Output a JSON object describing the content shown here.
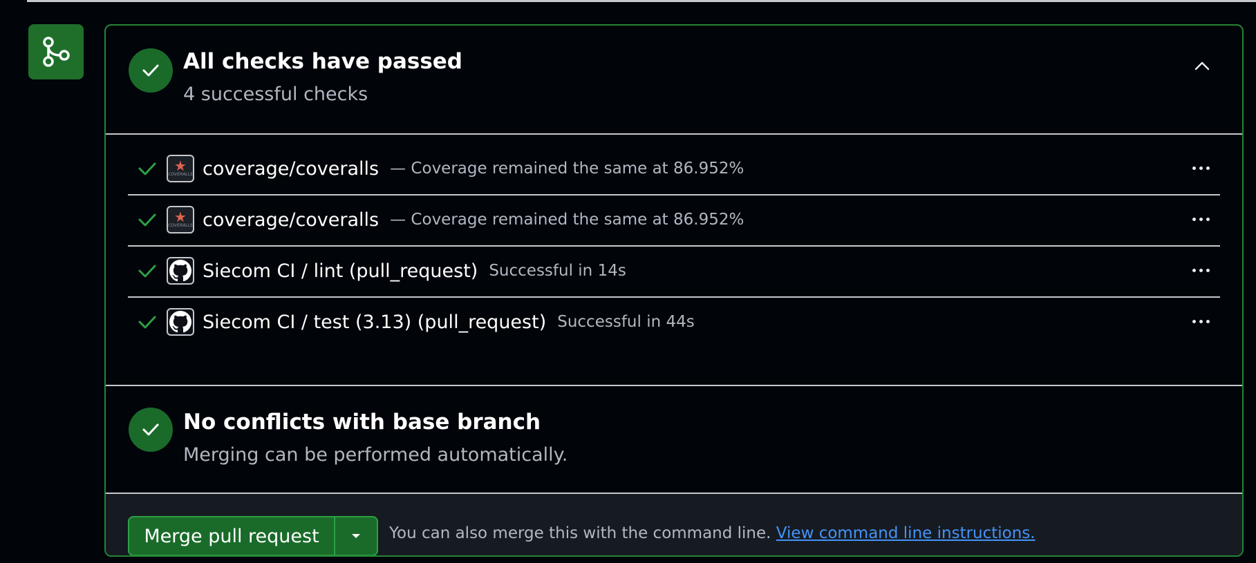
{
  "summary": {
    "title": "All checks have passed",
    "subtitle": "4 successful checks"
  },
  "checks": [
    {
      "icon": "coveralls-icon",
      "name": "coverage/coveralls",
      "description": "— Coverage remained the same at 86.952%",
      "status": "success"
    },
    {
      "icon": "coveralls-icon",
      "name": "coverage/coveralls",
      "description": "— Coverage remained the same at 86.952%",
      "status": "success"
    },
    {
      "icon": "github-icon",
      "name": "Siecom CI / lint (pull_request)",
      "description": "Successful in 14s",
      "status": "success"
    },
    {
      "icon": "github-icon",
      "name": "Siecom CI / test (3.13) (pull_request)",
      "description": "Successful in 44s",
      "status": "success"
    }
  ],
  "coveralls_logo_text": "COVERALLS",
  "conflicts": {
    "title": "No conflicts with base branch",
    "subtitle": "Merging can be performed automatically."
  },
  "actions": {
    "merge_label": "Merge pull request",
    "cli_text": "You can also merge this with the command line.",
    "cli_link": "View command line instructions."
  },
  "colors": {
    "success": "#2ea043",
    "success_bg": "#1a6b2a",
    "link": "#4493f8",
    "background": "#010409"
  }
}
